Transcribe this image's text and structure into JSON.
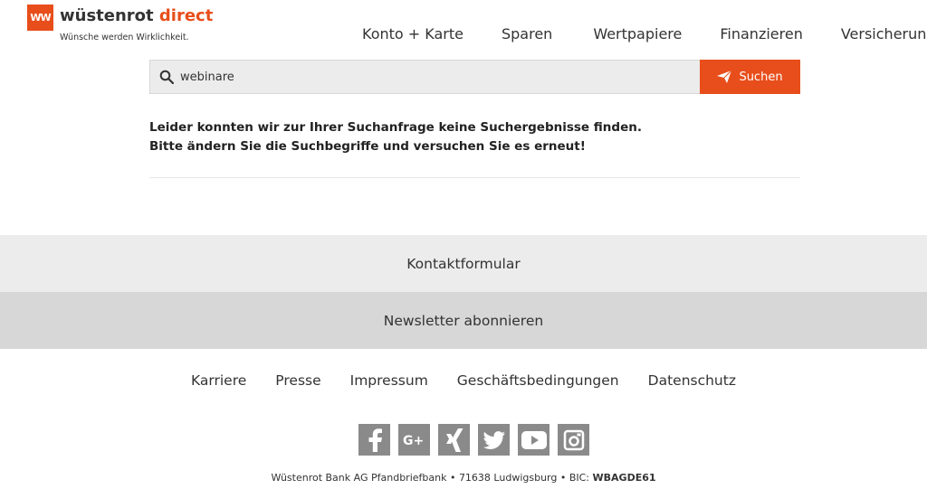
{
  "header": {
    "logo_mark": "WW",
    "brand_name": "wüstenrot",
    "brand_accent": "direct",
    "tagline": "Wünsche werden Wirklichkeit.",
    "nav": [
      "Konto + Karte",
      "Sparen",
      "Wertpapiere",
      "Finanzieren",
      "Versicherungen"
    ]
  },
  "search": {
    "value": "webinare",
    "button_label": "Suchen"
  },
  "results": {
    "message_line1": "Leider konnten wir zur Ihrer Suchanfrage keine Suchergebnisse finden.",
    "message_line2": "Bitte ändern Sie die Suchbegriffe und versuchen Sie es erneut!"
  },
  "footer": {
    "contact": "Kontaktformular",
    "newsletter": "Newsletter abonnieren",
    "links": [
      "Karriere",
      "Presse",
      "Impressum",
      "Geschäftsbedingungen",
      "Datenschutz"
    ],
    "social": [
      "facebook-icon",
      "google-plus-icon",
      "xing-icon",
      "twitter-icon",
      "youtube-icon",
      "instagram-icon"
    ],
    "legal_text": "Wüstenrot Bank AG Pfandbriefbank • 71638 Ludwigsburg • BIC: ",
    "legal_bic": "WBAGDE61"
  },
  "colors": {
    "accent": "#e84e1b",
    "band_light": "#ececec",
    "band_dark": "#d7d7d7",
    "icon_gray": "#8a8a8a"
  }
}
